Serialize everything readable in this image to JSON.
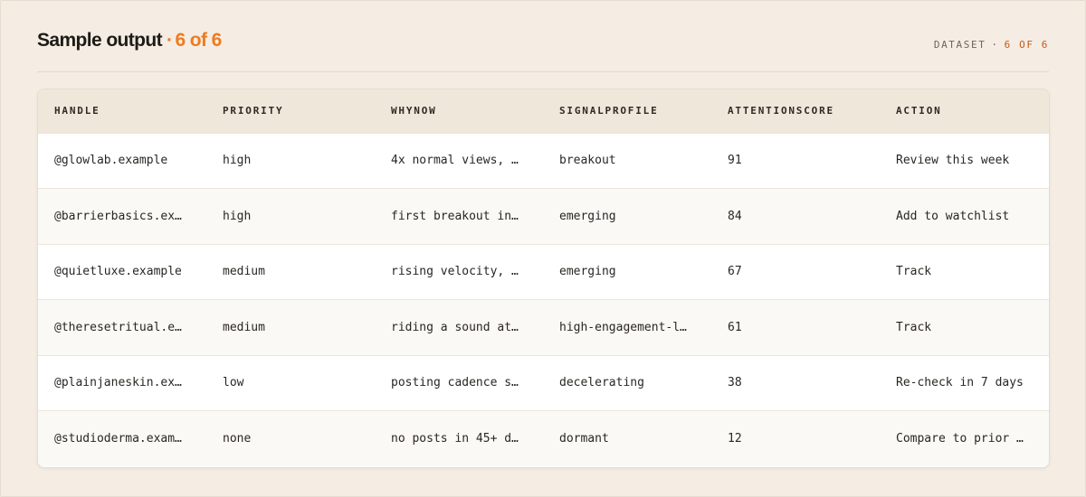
{
  "header": {
    "title": "Sample output",
    "separator": "·",
    "count": "6 of 6",
    "dataset_label": "DATASET",
    "dataset_separator": "·",
    "dataset_count": "6 OF 6"
  },
  "table": {
    "columns": [
      "HANDLE",
      "PRIORITY",
      "WHYNOW",
      "SIGNALPROFILE",
      "ATTENTIONSCORE",
      "ACTION"
    ],
    "rows": [
      [
        "@glowlab.example",
        "high",
        "4x normal views, …",
        "breakout",
        "91",
        "Review this week"
      ],
      [
        "@barrierbasics.ex…",
        "high",
        "first breakout in…",
        "emerging",
        "84",
        "Add to watchlist"
      ],
      [
        "@quietluxe.example",
        "medium",
        "rising velocity, …",
        "emerging",
        "67",
        "Track"
      ],
      [
        "@theresetritual.e…",
        "medium",
        "riding a sound at…",
        "high-engagement-l…",
        "61",
        "Track"
      ],
      [
        "@plainjaneskin.ex…",
        "low",
        "posting cadence s…",
        "decelerating",
        "38",
        "Re-check in 7 days"
      ],
      [
        "@studioderma.exam…",
        "none",
        "no posts in 45+ d…",
        "dormant",
        "12",
        "Compare to prior …"
      ]
    ]
  },
  "colors": {
    "page_background": "#f5ede3",
    "accent": "#f07a1e",
    "header_row_background": "#f0e7db"
  }
}
